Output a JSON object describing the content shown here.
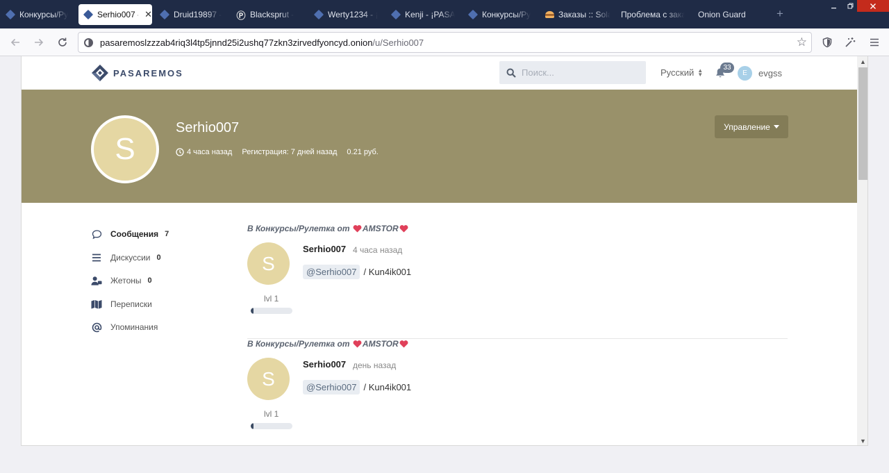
{
  "browser": {
    "tabs": [
      {
        "label": "Конкурсы/Ру",
        "icon": "diamond",
        "active": false
      },
      {
        "label": "Serhio007 -",
        "icon": "diamond",
        "active": true
      },
      {
        "label": "Druid19897 - ",
        "icon": "diamond",
        "active": false
      },
      {
        "label": "Blacksprut - ",
        "icon": "p-logo",
        "active": false
      },
      {
        "label": "Werty1234 - ¡P",
        "icon": "diamond",
        "active": false
      },
      {
        "label": "Kenji - ¡PASA",
        "icon": "diamond",
        "active": false
      },
      {
        "label": "Конкурсы/Ру",
        "icon": "diamond",
        "active": false
      },
      {
        "label": "Заказы :: Sola",
        "icon": "burger",
        "active": false
      },
      {
        "label": "Проблема с зака",
        "icon": "none",
        "active": false
      },
      {
        "label": "Onion Guard",
        "icon": "none",
        "active": false
      }
    ],
    "tab_close_glyph": "✕",
    "new_tab_glyph": "+",
    "url_host": "pasaremoslzzzab4riq3l4tp5jnnd25i2ushq77zkn3zirvedfyoncyd.onion",
    "url_path": "/u/Serhio007"
  },
  "site": {
    "logo_text": "PASAREMOS",
    "search_placeholder": "Поиск...",
    "language": "Русский",
    "notifications_count": "33",
    "user_initial": "E",
    "username": "evgss"
  },
  "profile": {
    "initial": "S",
    "name": "Serhio007",
    "last_seen": "4 часа назад",
    "registered": "Регистрация: 7 дней назад",
    "balance": "0.21 руб.",
    "manage_label": "Управление"
  },
  "profile_nav": [
    {
      "label": "Сообщения",
      "count": "7",
      "icon": "comment-icon",
      "active": true
    },
    {
      "label": "Дискуссии",
      "count": "0",
      "icon": "list-icon",
      "active": false
    },
    {
      "label": "Жетоны",
      "count": "0",
      "icon": "user-token-icon",
      "active": false
    },
    {
      "label": "Переписки",
      "count": "",
      "icon": "map-icon",
      "active": false
    },
    {
      "label": "Упоминания",
      "count": "",
      "icon": "at-icon",
      "active": false
    }
  ],
  "posts": [
    {
      "header_prefix": "В Конкурсы/Рулетка от",
      "header_author": "AMSTOR",
      "avatar_initial": "S",
      "level": "lvl 1",
      "level_progress": 0.06,
      "author": "Serhio007",
      "time": "4 часа назад",
      "mention": "@Serhio007",
      "text": "/ Kun4ik001"
    },
    {
      "header_prefix": "В Конкурсы/Рулетка от",
      "header_author": "AMSTOR",
      "avatar_initial": "S",
      "level": "lvl 1",
      "level_progress": 0.06,
      "author": "Serhio007",
      "time": "день назад",
      "mention": "@Serhio007",
      "text": "/ Kun4ik001"
    }
  ],
  "colors": {
    "banner": "#99916a",
    "avatar": "#e5d7a3",
    "tabbar": "#1f2b46",
    "heart": "#e0405a"
  }
}
